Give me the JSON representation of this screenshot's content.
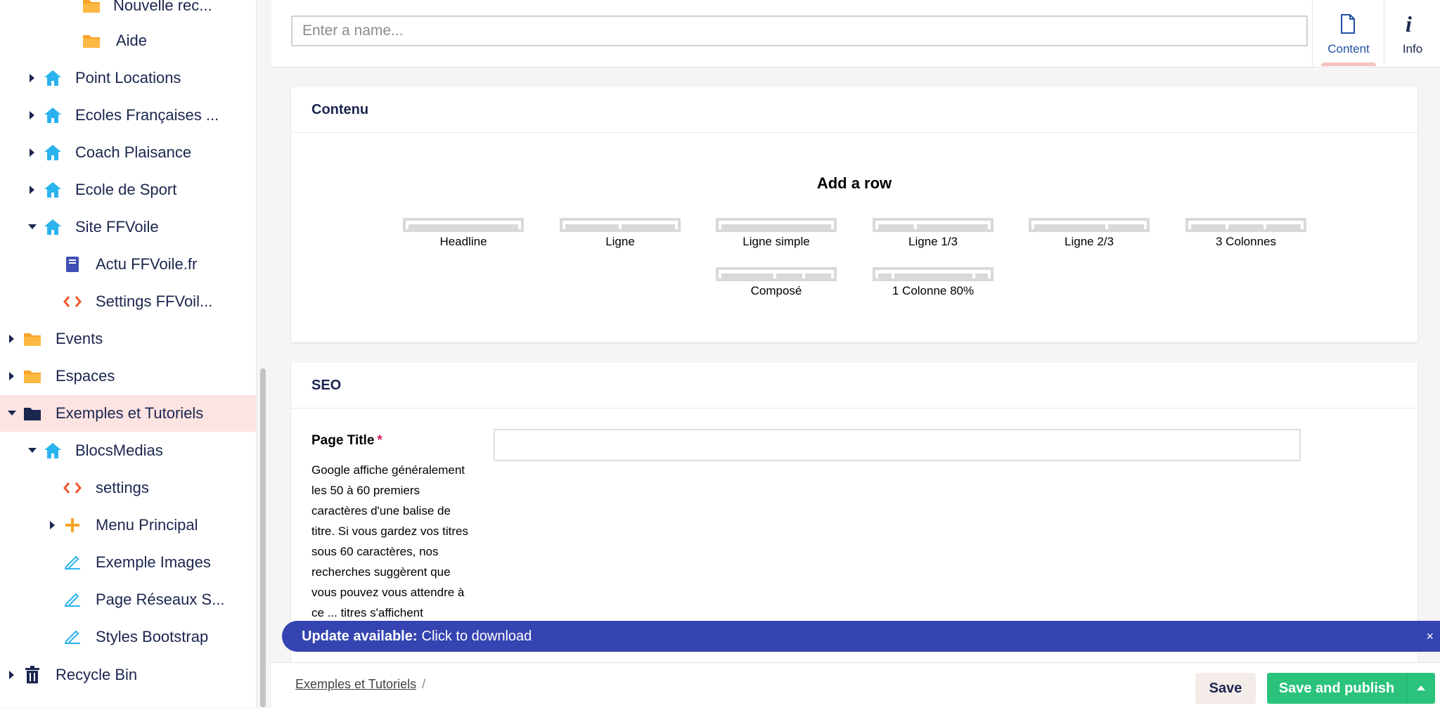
{
  "sidebar": {
    "items": [
      {
        "label": "Nouvelle rec...",
        "icon": "folder-icon"
      },
      {
        "label": "Aide",
        "icon": "folder-icon"
      },
      {
        "label": "Point Locations",
        "icon": "home-icon"
      },
      {
        "label": "Ecoles Françaises ...",
        "icon": "home-icon"
      },
      {
        "label": "Coach Plaisance",
        "icon": "home-icon"
      },
      {
        "label": "Ecole de Sport",
        "icon": "home-icon"
      },
      {
        "label": "Site FFVoile",
        "icon": "home-icon"
      },
      {
        "label": "Actu FFVoile.fr",
        "icon": "book-icon"
      },
      {
        "label": "Settings FFVoil...",
        "icon": "code-icon"
      },
      {
        "label": "Events",
        "icon": "folder-icon"
      },
      {
        "label": "Espaces",
        "icon": "folder-icon"
      },
      {
        "label": "Exemples et Tutoriels",
        "icon": "folder-dark-icon"
      },
      {
        "label": "BlocsMedias",
        "icon": "home-icon"
      },
      {
        "label": "settings",
        "icon": "code-icon"
      },
      {
        "label": "Menu Principal",
        "icon": "plus-icon"
      },
      {
        "label": "Exemple Images",
        "icon": "edit-icon"
      },
      {
        "label": "Page Réseaux S...",
        "icon": "edit-icon"
      },
      {
        "label": "Styles Bootstrap",
        "icon": "edit-icon"
      },
      {
        "label": "Recycle Bin",
        "icon": "trash-icon"
      }
    ]
  },
  "header": {
    "name_placeholder": "Enter a name...",
    "tabs": [
      {
        "label": "Content",
        "icon": "document-icon"
      },
      {
        "label": "Info",
        "icon": "info-icon"
      }
    ]
  },
  "contenu": {
    "title": "Contenu",
    "add_row": "Add a row",
    "layouts": [
      "Headline",
      "Ligne",
      "Ligne simple",
      "Ligne 1/3",
      "Ligne 2/3",
      "3 Colonnes",
      "Composé",
      "1 Colonne 80%"
    ]
  },
  "seo": {
    "title": "SEO",
    "page_title_label": "Page Title",
    "required_mark": "*",
    "description": "Google affiche généralement les 50 à 60 premiers caractères d'une balise de titre. Si vous gardez vos titres sous 60 caractères, nos recherches suggèrent que vous pouvez vous attendre à ce ... titres s'affichent"
  },
  "update": {
    "bold": "Update available:",
    "text": "Click to download",
    "close": "×"
  },
  "footer": {
    "breadcrumb": "Exemples et Tutoriels",
    "separator": "/",
    "save": "Save",
    "publish": "Save and publish"
  },
  "colors": {
    "accent_blue": "#2152a3",
    "home_icon": "#2bb3ef",
    "folder_icon": "#f7a428",
    "code_icon": "#f0592a",
    "selected_row": "#fde3e1",
    "banner": "#3544b1",
    "publish": "#2bc37c"
  }
}
